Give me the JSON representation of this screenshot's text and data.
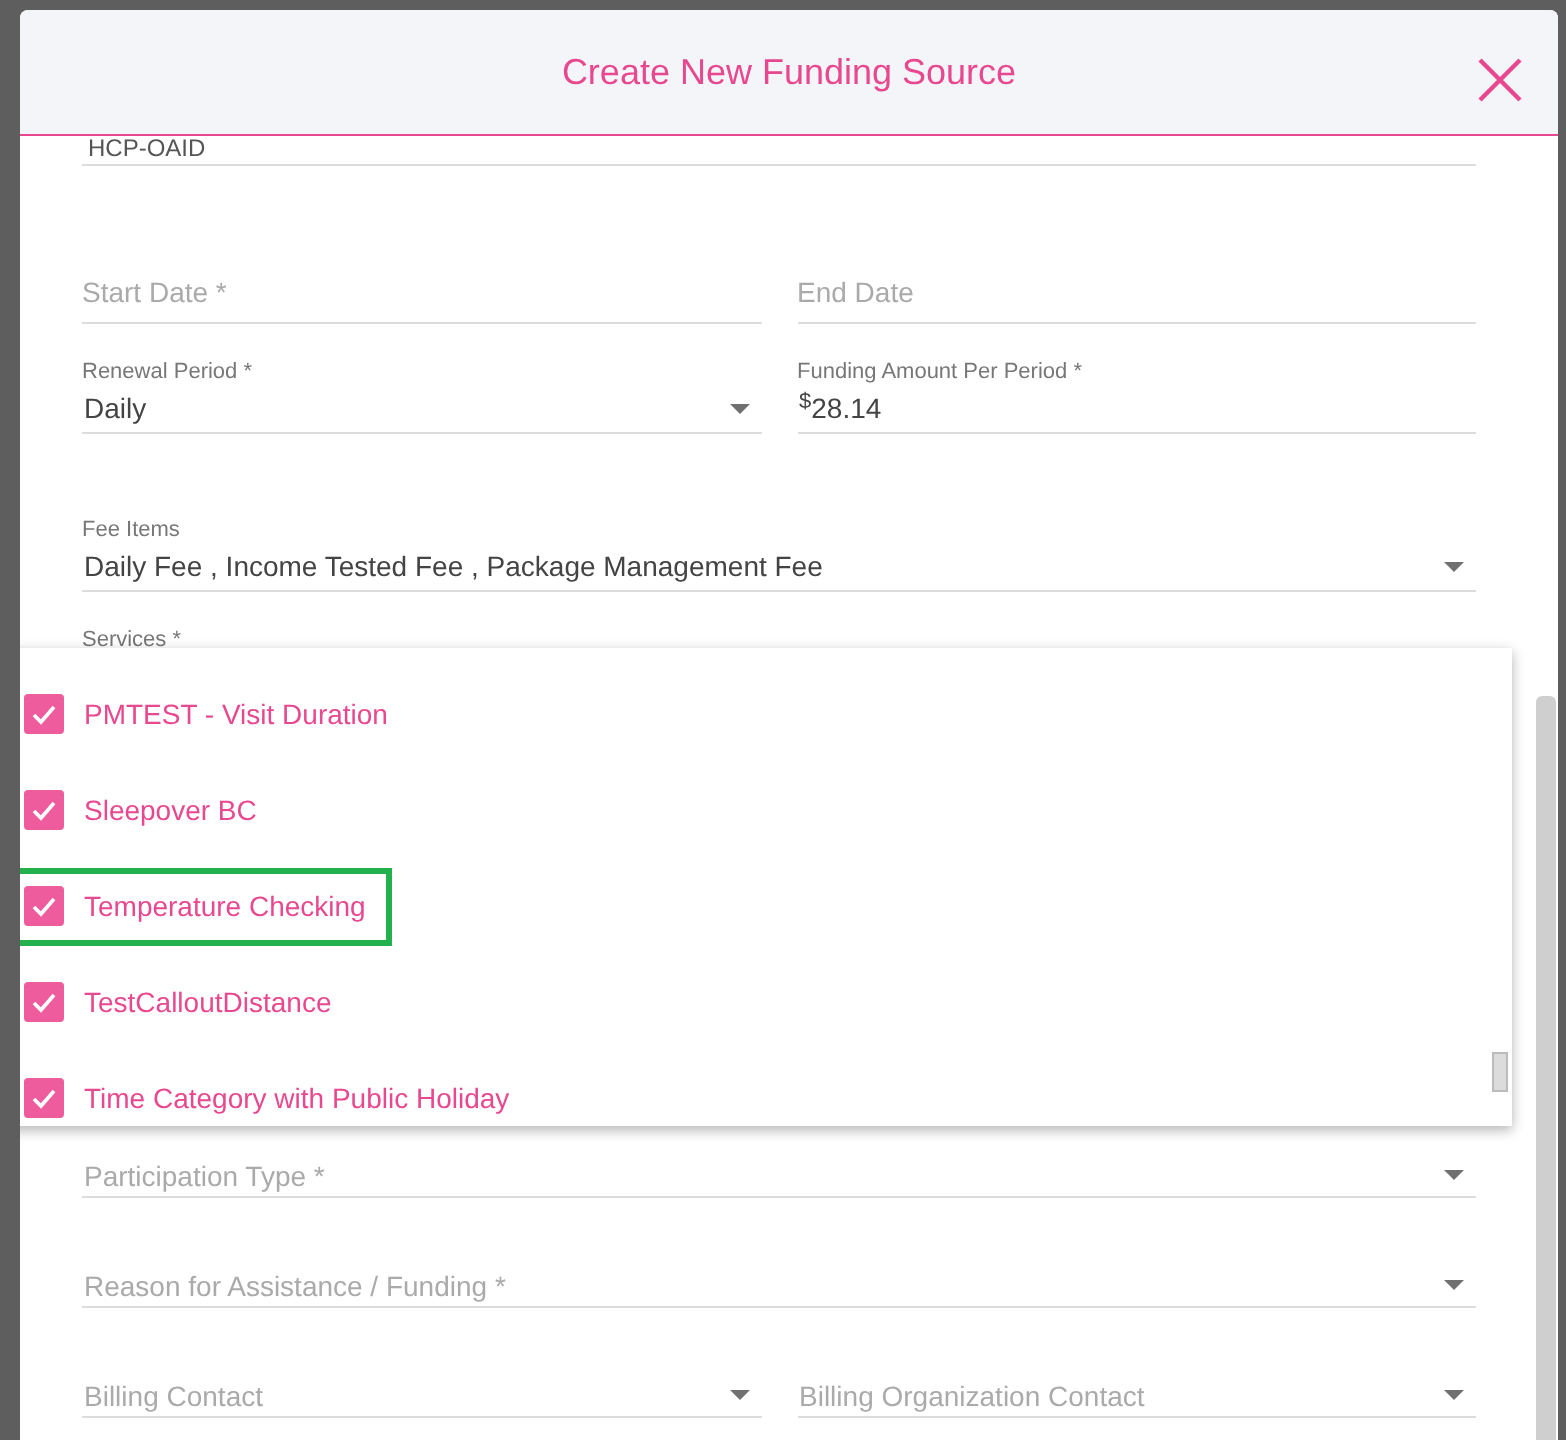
{
  "dialog": {
    "title": "Create New Funding Source"
  },
  "fields_top": [
    {
      "value": "HCP-OAID"
    }
  ],
  "date_row": [
    {
      "placeholder": "Start Date *"
    },
    {
      "placeholder": "End Date"
    }
  ],
  "amount_row": [
    {
      "kind": "select",
      "label": "Renewal Period *",
      "value": "Daily"
    },
    {
      "kind": "currency",
      "label": "Funding Amount Per Period *",
      "prefix": "$",
      "value": "28.14"
    }
  ],
  "fee_items": {
    "label": "Fee Items",
    "value": "Daily Fee , Income Tested Fee , Package Management Fee"
  },
  "services": {
    "label": "Services *",
    "options": [
      {
        "label": "PMTEST - Visit Duration",
        "checked": true,
        "highlighted": false
      },
      {
        "label": "Sleepover BC",
        "checked": true,
        "highlighted": false
      },
      {
        "label": "Temperature Checking",
        "checked": true,
        "highlighted": true
      },
      {
        "label": "TestCalloutDistance",
        "checked": true,
        "highlighted": false
      },
      {
        "label": "Time Category with Public Holiday",
        "checked": true,
        "highlighted": false
      }
    ]
  },
  "participation_type": {
    "placeholder": "Participation Type *"
  },
  "reason": {
    "placeholder": "Reason for Assistance / Funding *"
  },
  "billing_row": [
    {
      "placeholder": "Billing Contact"
    },
    {
      "placeholder": "Billing Organization Contact"
    }
  ]
}
